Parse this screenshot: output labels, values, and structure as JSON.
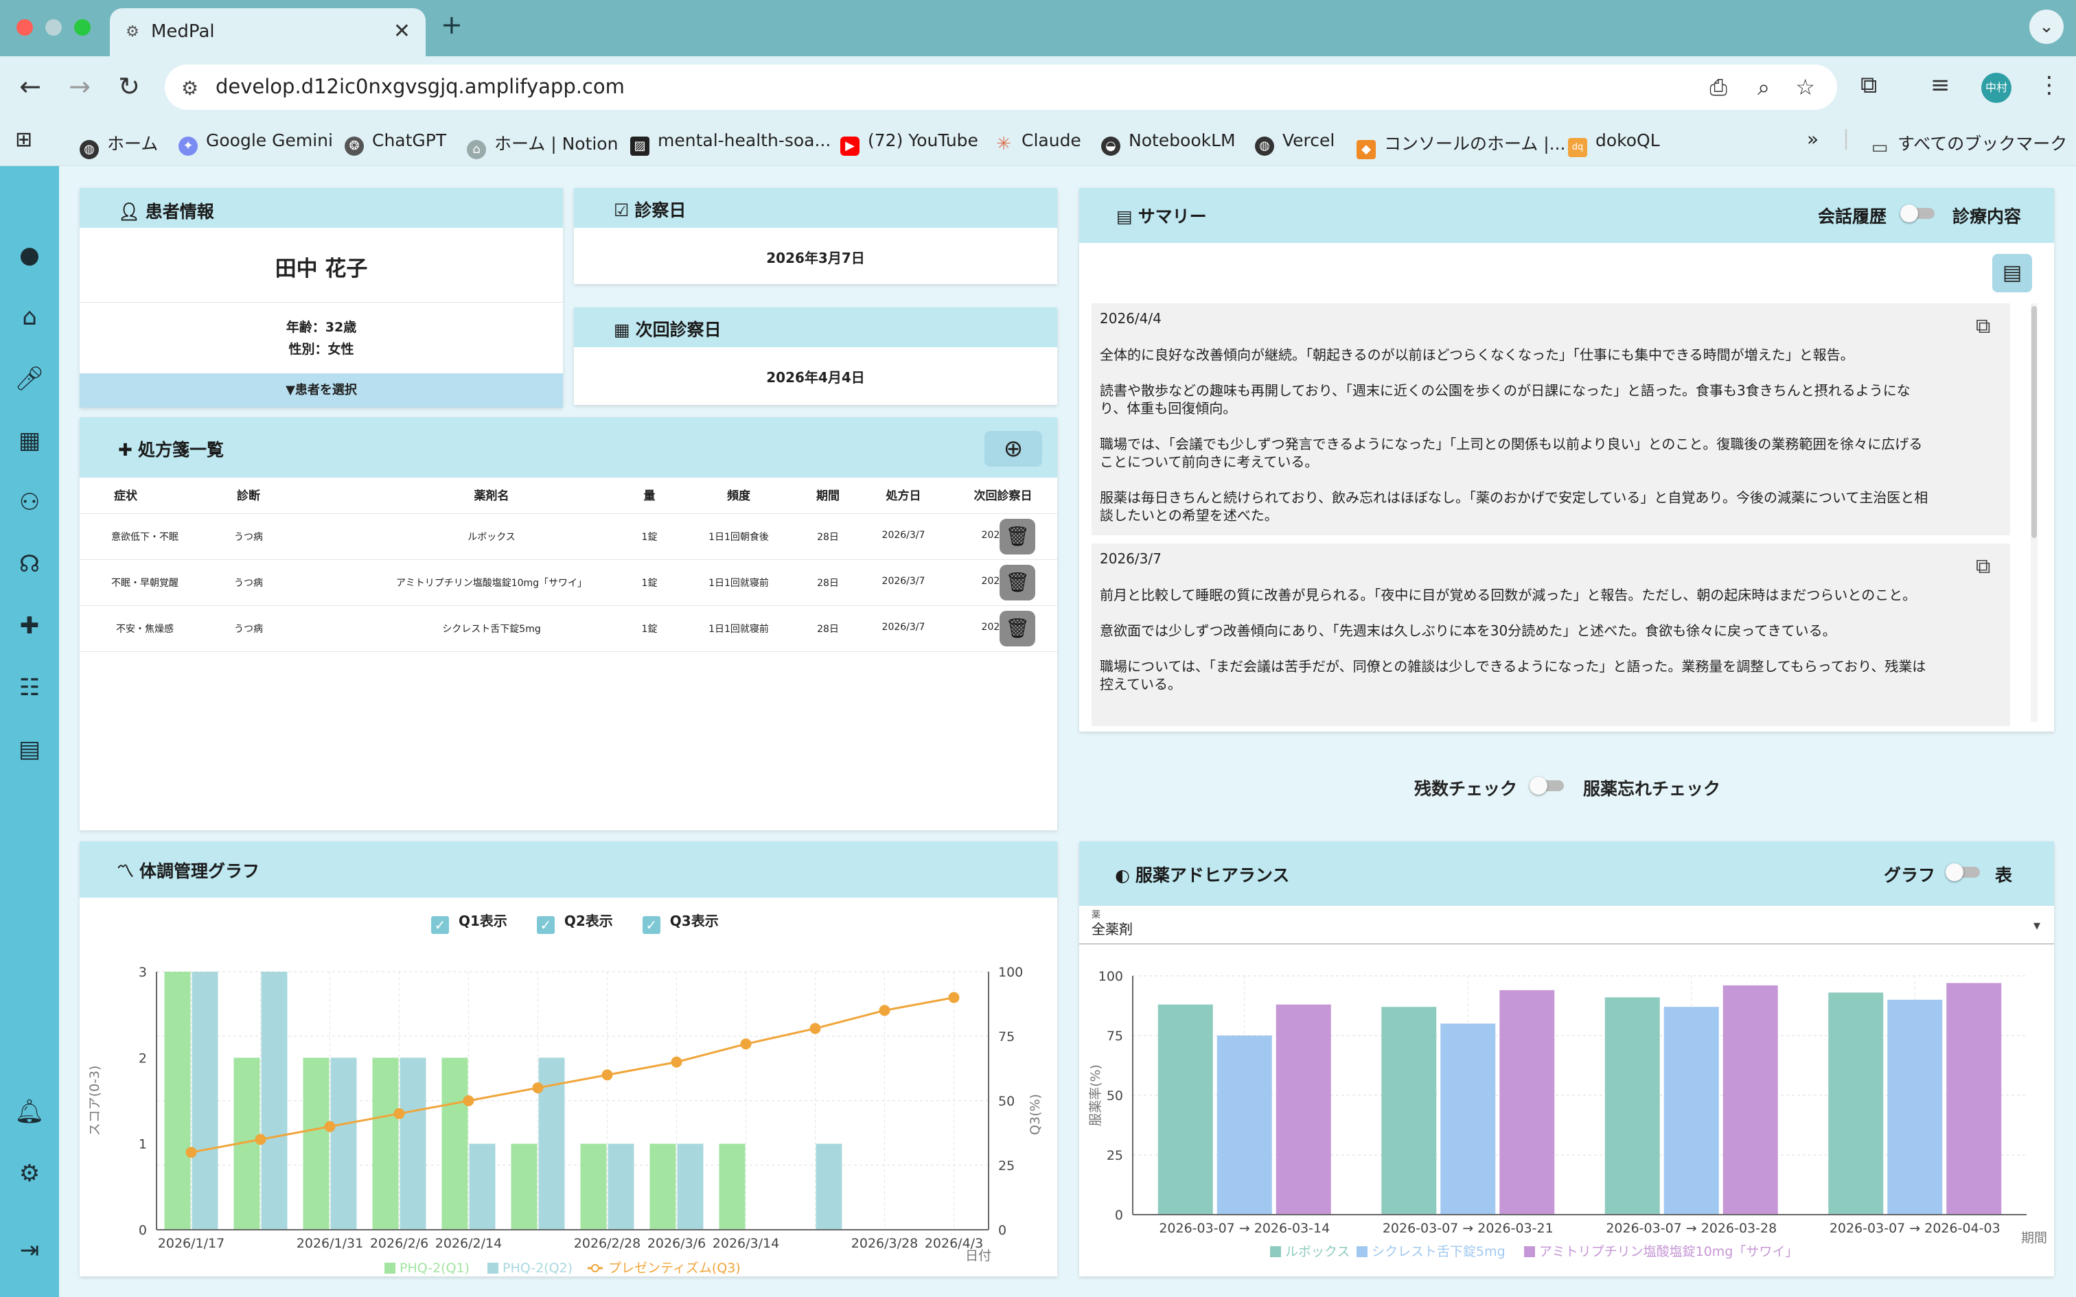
{
  "browser": {
    "tab_title": "MedPal",
    "url": "develop.d12ic0nxgvsgjq.amplifyapp.com",
    "avatar_label": "中村",
    "bookmarks": [
      "ホーム",
      "Google Gemini",
      "ChatGPT",
      "ホーム | Notion",
      "mental-health-soa...",
      "(72) YouTube",
      "Claude",
      "NotebookLM",
      "Vercel",
      "コンソールのホーム |...",
      "dokoQL"
    ],
    "all_bookmarks_label": "すべてのブックマーク"
  },
  "patient": {
    "header": "患者情報",
    "name": "田中 花子",
    "age": "年齢：32歳",
    "gender": "性別：女性",
    "select_label": "▼患者を選択"
  },
  "visit": {
    "header": "診察日",
    "date": "2026年3月7日",
    "next_header": "次回診察日",
    "next_date": "2026年4月4日"
  },
  "prescriptions": {
    "header": "処方箋一覧",
    "columns": [
      "症状",
      "診断",
      "薬剤名",
      "量",
      "頻度",
      "期間",
      "処方日",
      "次回診察日"
    ],
    "rows": [
      [
        "意欲低下・不眠",
        "うつ病",
        "ルボックス",
        "1錠",
        "1日1回朝食後",
        "28日",
        "2026/3/7",
        "2026/4/4"
      ],
      [
        "不眠・早朝覚醒",
        "うつ病",
        "アミトリプチリン塩酸塩錠10mg「サワイ」",
        "1錠",
        "1日1回就寝前",
        "28日",
        "2026/3/7",
        "2026/4/4"
      ],
      [
        "不安・焦燥感",
        "うつ病",
        "シクレスト舌下錠5mg",
        "1錠",
        "1日1回就寝前",
        "28日",
        "2026/3/7",
        "2026/4/4"
      ]
    ]
  },
  "summary": {
    "header": "サマリー",
    "toggle_left": "会話履歴",
    "toggle_right": "診療内容",
    "entries": [
      {
        "date": "2026/4/4",
        "paragraphs": [
          "全体的に良好な改善傾向が継続。「朝起きるのが以前ほどつらくなくなった」「仕事にも集中できる時間が増えた」と報告。",
          "読書や散歩などの趣味も再開しており、「週末に近くの公園を歩くのが日課になった」と語った。食事も3食きちんと摂れるようにな\nり、体重も回復傾向。",
          "職場では、「会議でも少しずつ発言できるようになった」「上司との関係も以前より良い」とのこと。復職後の業務範囲を徐々に広げる\nことについて前向きに考えている。",
          "服薬は毎日きちんと続けられており、飲み忘れはほぼなし。「薬のおかげで安定している」と自覚あり。今後の減薬について主治医と相\n談したいとの希望を述べた。"
        ]
      },
      {
        "date": "2026/3/7",
        "paragraphs": [
          "前月と比較して睡眠の質に改善が見られる。「夜中に目が覚める回数が減った」と報告。ただし、朝の起床時はまだつらいとのこと。",
          "意欲面では少しずつ改善傾向にあり、「先週末は久しぶりに本を30分読めた」と述べた。食欲も徐々に戻ってきている。",
          "職場については、「まだ会議は苦手だが、同僚との雑談は少しできるようになった」と語った。業務量を調整してもらっており、残業は\n控えている。"
        ]
      }
    ]
  },
  "check": {
    "left": "残数チェック",
    "right": "服薬忘れチェック"
  },
  "health_chart": {
    "header": "体調管理グラフ",
    "checkboxes": [
      "Q1表示",
      "Q2表示",
      "Q3表示"
    ],
    "colors": {
      "q1": "#a3e4a1",
      "q2": "#a8d8de",
      "q3": "#f0a53a"
    }
  },
  "adherence": {
    "header": "服薬アドヒアランス",
    "toggle_left": "グラフ",
    "toggle_right": "表",
    "select_label": "薬",
    "select_value": "全薬剤",
    "colors": [
      "#8ecbbf",
      "#a0c8f0",
      "#c697d6"
    ]
  },
  "chart_data": [
    {
      "type": "bar",
      "secondary_type": "line",
      "categories": [
        "2026/1/17",
        "2026/1/24",
        "2026/1/31",
        "2026/2/6",
        "2026/2/14",
        "2026/2/21",
        "2026/2/28",
        "2026/3/6",
        "2026/3/14",
        "2026/3/21",
        "2026/3/28",
        "2026/4/3"
      ],
      "x_tick_labels": [
        "2026/1/17",
        "2026/1/31",
        "2026/2/6",
        "2026/2/14",
        "2026/2/28",
        "2026/3/6",
        "2026/3/14",
        "2026/3/28",
        "2026/4/3"
      ],
      "series": [
        {
          "name": "PHQ-2(Q1)",
          "axis": "left",
          "values": [
            3,
            2,
            2,
            2,
            2,
            1,
            1,
            1,
            1,
            null,
            null,
            null
          ]
        },
        {
          "name": "PHQ-2(Q2)",
          "axis": "left",
          "values": [
            3,
            3,
            2,
            2,
            1,
            2,
            1,
            1,
            null,
            1,
            null,
            null
          ]
        },
        {
          "name": "プレゼンティズム(Q3)",
          "axis": "right",
          "type": "line",
          "values": [
            30,
            35,
            40,
            45,
            50,
            55,
            60,
            65,
            72,
            78,
            85,
            90
          ]
        }
      ],
      "xlabel": "日付",
      "ylabel": "スコア(0-3)",
      "y2label": "Q3(%)",
      "ylim": [
        0,
        3
      ],
      "y2lim": [
        0,
        100
      ],
      "yticks": [
        0,
        1,
        2,
        3
      ],
      "y2ticks": [
        0,
        25,
        50,
        75,
        100
      ],
      "grid": true,
      "legend": "bottom"
    },
    {
      "type": "bar",
      "categories": [
        "2026-03-07 → 2026-03-14",
        "2026-03-07 → 2026-03-21",
        "2026-03-07 → 2026-03-28",
        "2026-03-07 → 2026-04-03"
      ],
      "series": [
        {
          "name": "ルボックス",
          "values": [
            88,
            87,
            91,
            93
          ]
        },
        {
          "name": "シクレスト舌下錠5mg",
          "values": [
            75,
            80,
            87,
            90
          ]
        },
        {
          "name": "アミトリプチリン塩酸塩錠10mg「サワイ」",
          "values": [
            88,
            94,
            96,
            97
          ]
        }
      ],
      "xlabel": "期間",
      "ylabel": "服薬率(%)",
      "ylim": [
        0,
        100
      ],
      "yticks": [
        0,
        25,
        50,
        75,
        100
      ],
      "grid": true,
      "legend": "bottom"
    }
  ]
}
